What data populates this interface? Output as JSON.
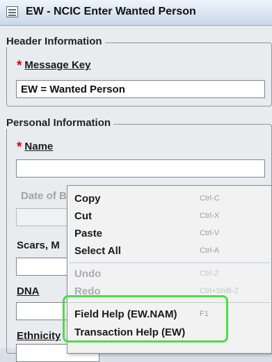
{
  "window": {
    "title": "EW - NCIC Enter Wanted Person",
    "icon": "window-icon"
  },
  "header_section": {
    "label": "Header Information",
    "message_key_label": "Message Key",
    "message_key_value": "EW = Wanted Person"
  },
  "personal_section": {
    "label": "Personal Information",
    "name_label": "Name",
    "dob_label": "Date of B",
    "scars_label": "Scars, M",
    "dna_label": "DNA",
    "ethnicity_label": "Ethnicity"
  },
  "context_menu": {
    "items": [
      {
        "label": "Copy",
        "shortcut": "Ctrl-C",
        "enabled": true
      },
      {
        "label": "Cut",
        "shortcut": "Ctrl-X",
        "enabled": true
      },
      {
        "label": "Paste",
        "shortcut": "Ctrl-V",
        "enabled": true
      },
      {
        "label": "Select All",
        "shortcut": "Ctrl-A",
        "enabled": true
      },
      {
        "label": "Undo",
        "shortcut": "Ctrl-Z",
        "enabled": false
      },
      {
        "label": "Redo",
        "shortcut": "Ctrl+Shift-Z",
        "enabled": false
      },
      {
        "label": "Field Help (EW.NAM)",
        "shortcut": "F1",
        "enabled": true
      },
      {
        "label": "Transaction Help (EW)",
        "shortcut": "",
        "enabled": true
      }
    ]
  },
  "colors": {
    "required_star": "#e00000",
    "highlight": "#4ddb4d"
  }
}
